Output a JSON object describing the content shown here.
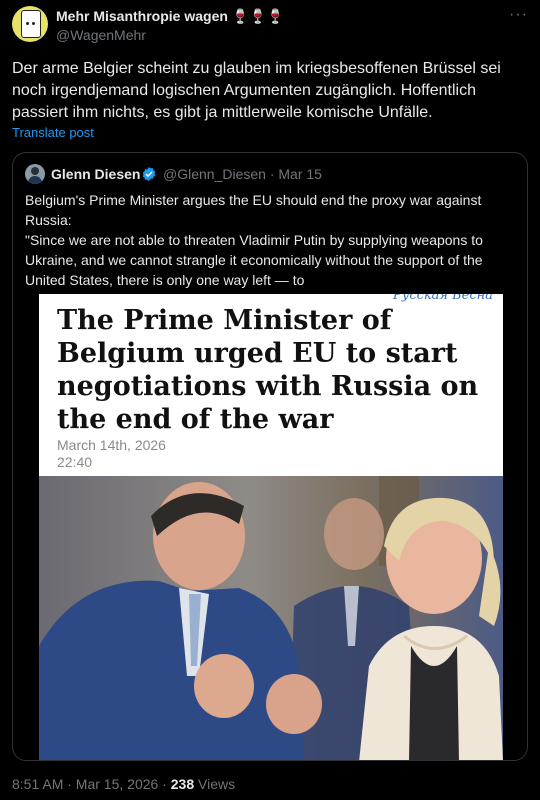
{
  "author": {
    "name": "Mehr Misanthropie wagen 🍷🍷🍷",
    "handle": "@WagenMehr"
  },
  "tweet": {
    "text": "Der arme Belgier scheint zu glauben im kriegsbesoffenen Brüssel sei noch irgendjemand logischen Argumenten zugänglich. Hoffentlich passiert ihm nichts, es gibt ja mittlerweile komische Unfälle.",
    "translate_label": "Translate post",
    "more_icon": "more-icon"
  },
  "quote": {
    "name": "Glenn Diesen",
    "handle_date": "@Glenn_Diesen · Mar 15",
    "lines": [
      "Belgium's Prime Minister argues the EU should end the proxy war against",
      "Russia:",
      "\"Since we are not able to threaten Vladimir Putin by supplying weapons to",
      "Ukraine, and we cannot strangle it economically without the support of the",
      "United States, there is only one way left — to"
    ],
    "media": {
      "source_label": "Русская Весна",
      "headline": "The Prime Minister of Belgium urged EU to start negotiations with Russia on the end of the war",
      "date": "March 14th, 2026",
      "time": "22:40"
    }
  },
  "footer": {
    "timestamp": "8:51 AM · Mar 15, 2026 · ",
    "views_count": "238",
    "views_label": " Views"
  },
  "colors": {
    "background": "#000000",
    "text": "#e7e9ea",
    "secondary": "#71767b",
    "link": "#1d9bf0",
    "border": "#2f3336"
  }
}
